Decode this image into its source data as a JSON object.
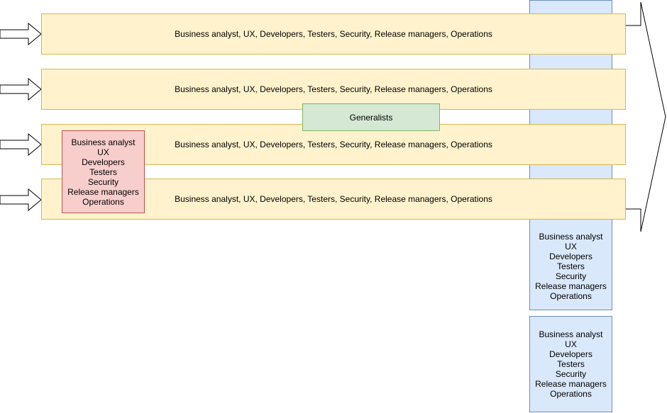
{
  "diagram": {
    "rows": [
      {
        "label": "Business analyst, UX, Developers, Testers, Security, Release managers, Operations"
      },
      {
        "label": "Business analyst, UX, Developers, Testers, Security, Release managers, Operations"
      },
      {
        "label": "Business analyst, UX, Developers, Testers, Security, Release managers, Operations"
      },
      {
        "label": "Business analyst, UX, Developers, Testers, Security, Release managers, Operations"
      }
    ],
    "generalists_label": "Generalists",
    "specialist_box": {
      "lines": [
        "Business analyst",
        "UX",
        "Developers",
        "Testers",
        "Security",
        "Release managers",
        "Operations"
      ]
    },
    "blue_box_1": {
      "lines": [
        "Business analyst",
        "UX",
        "Developers",
        "Testers",
        "Security",
        "Release managers",
        "Operations"
      ]
    },
    "blue_box_2": {
      "lines": [
        "Business analyst",
        "UX",
        "Developers",
        "Testers",
        "Security",
        "Release managers",
        "Operations"
      ]
    },
    "colors": {
      "band_fill": "#fff2cc",
      "band_stroke": "#d6b656",
      "red_fill": "#f8cecc",
      "red_stroke": "#b85450",
      "blue_fill": "#dae8fc",
      "blue_stroke": "#6c8ebf",
      "green_fill": "#d5e8d4",
      "green_stroke": "#82b366"
    }
  }
}
